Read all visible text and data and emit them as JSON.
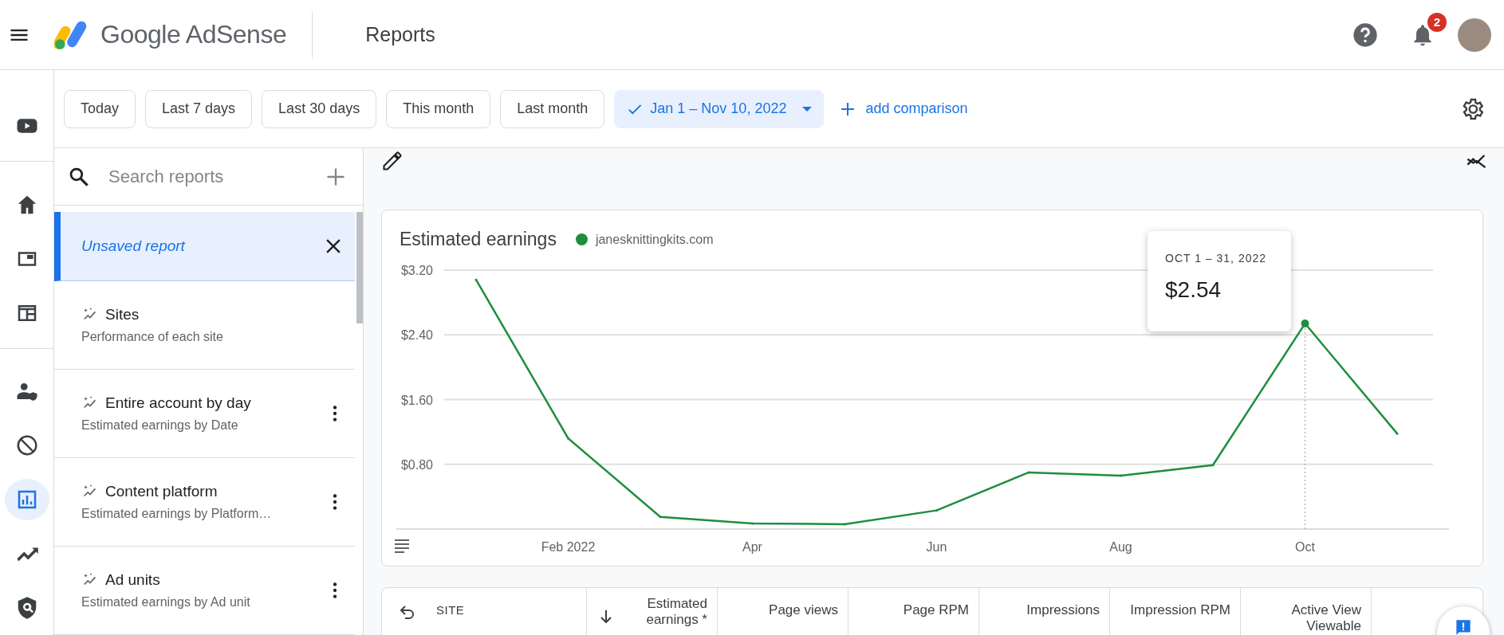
{
  "top_bar": {
    "product": "Google AdSense",
    "page_title": "Reports",
    "notifications": "2"
  },
  "nav_rail": [
    {
      "selected": false
    },
    {
      "selected": false
    },
    {
      "selected": false
    },
    {
      "selected": false
    },
    {
      "selected": false
    },
    {
      "selected": false
    },
    {
      "selected": true
    },
    {
      "selected": false
    },
    {
      "selected": false
    }
  ],
  "date_chips": [
    {
      "label": "Today",
      "selected": false
    },
    {
      "label": "Last 7 days",
      "selected": false
    },
    {
      "label": "Last 30 days",
      "selected": false
    },
    {
      "label": "This month",
      "selected": false
    },
    {
      "label": "Last month",
      "selected": false
    },
    {
      "label": "Jan 1 – Nov 10, 2022",
      "selected": true
    }
  ],
  "add_comparison": "add comparison",
  "reports": {
    "search": {
      "placeholder": "Search reports"
    },
    "items": [
      {
        "title": "Unsaved report",
        "selected": true
      },
      {
        "title": "Sites",
        "subtitle": "Performance of each site",
        "selected": false,
        "menu": false
      },
      {
        "title": "Entire account by day",
        "subtitle": "Estimated earnings by Date",
        "selected": false,
        "menu": true
      },
      {
        "title": "Content platform",
        "subtitle": "Estimated earnings by Platform…",
        "selected": false,
        "menu": true
      },
      {
        "title": "Ad units",
        "subtitle": "Estimated earnings by Ad unit",
        "selected": false,
        "menu": true
      }
    ]
  },
  "chart": {
    "points": [
      {
        "selected": false
      },
      {
        "selected": false
      },
      {
        "selected": false
      },
      {
        "selected": false
      },
      {
        "selected": false
      },
      {
        "selected": false
      },
      {
        "selected": false
      },
      {
        "selected": false
      },
      {
        "selected": false
      },
      {
        "selected": true
      },
      {
        "selected": false
      }
    ],
    "tooltip": {
      "period": "OCT 1 – 31, 2022",
      "value": "$2.54"
    },
    "chart_data": {
      "type": "line",
      "title": "Estimated earnings",
      "categories": [
        null,
        "Feb 2022",
        null,
        "Apr",
        null,
        "Jun",
        null,
        "Aug",
        null,
        "Oct",
        null
      ],
      "series": [
        {
          "name": "janesknittingkits.com",
          "color": "#1e8e3e",
          "values": [
            3.08,
            1.12,
            0.15,
            0.07,
            0.06,
            0.23,
            0.7,
            0.66,
            0.79,
            2.54,
            1.18
          ]
        }
      ],
      "ylim": [
        0,
        3.2
      ],
      "yticks": [
        {
          "value": 0.8,
          "label": "$0.80"
        },
        {
          "value": 1.6,
          "label": "$1.60"
        },
        {
          "value": 2.4,
          "label": "$2.40"
        },
        {
          "value": 3.2,
          "label": "$3.20"
        }
      ],
      "grid": true
    }
  },
  "table": {
    "columns": [
      {
        "label": "SITE",
        "kind": "dimension"
      },
      {
        "label": "Estimated earnings *",
        "kind": "sorted"
      },
      {
        "label": "Page views",
        "kind": "metric"
      },
      {
        "label": "Page RPM",
        "kind": "metric"
      },
      {
        "label": "Impressions",
        "kind": "metric"
      },
      {
        "label": "Impression RPM",
        "kind": "metric"
      },
      {
        "label": "Active View Viewable",
        "kind": "metric"
      }
    ]
  }
}
